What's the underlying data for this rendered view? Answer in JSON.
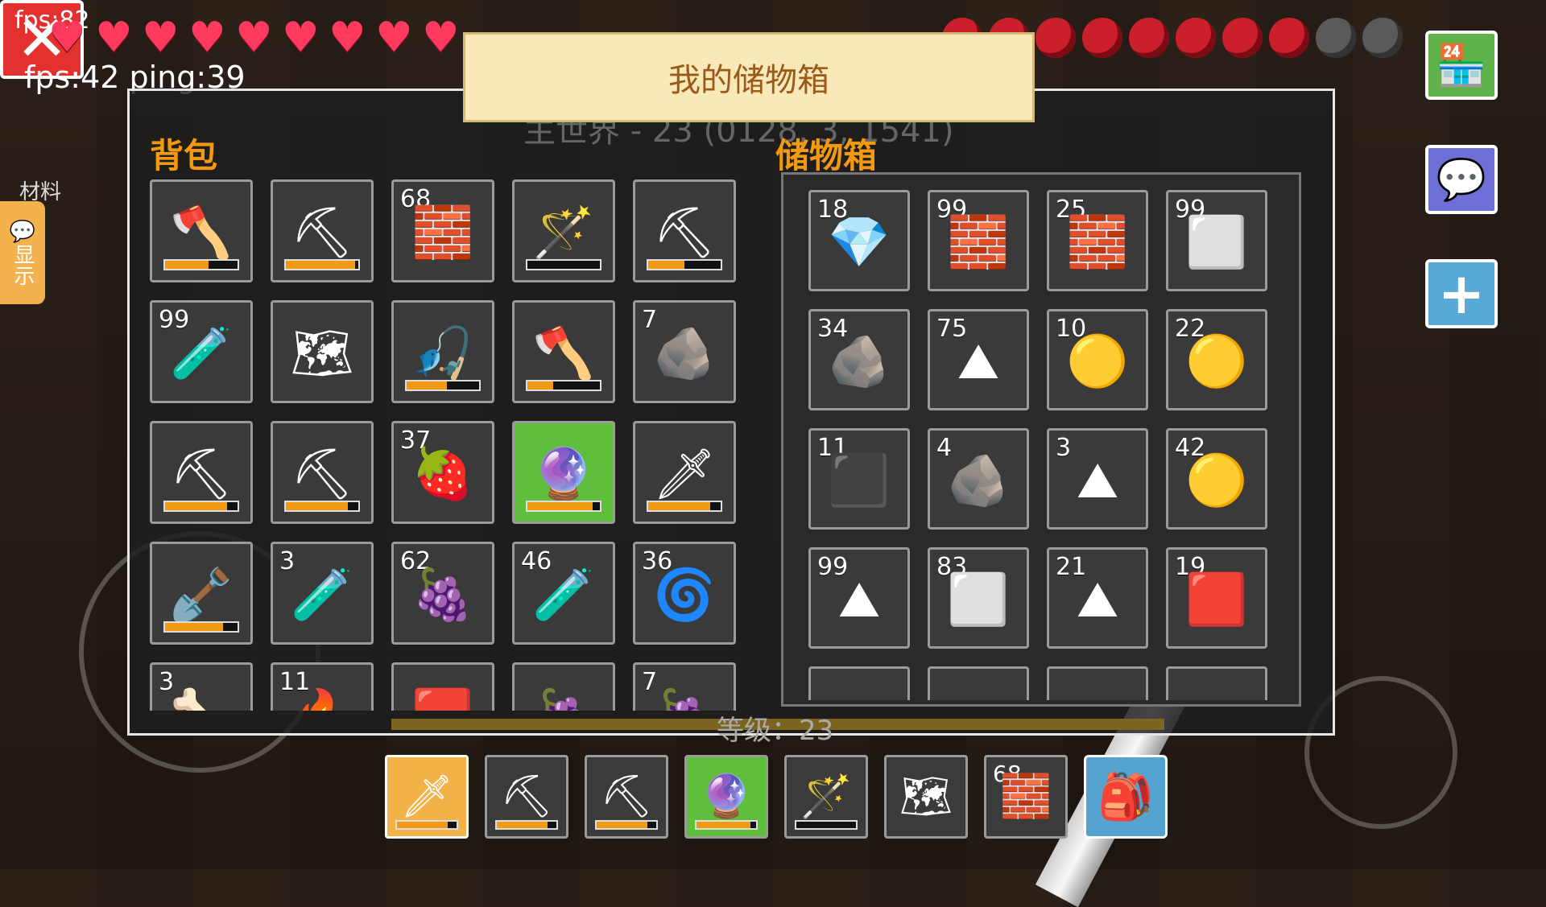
{
  "hud": {
    "fps_top": "fps:82",
    "fps_line": "fps:42 ping:39",
    "hearts": 9,
    "hunger_full": 8,
    "hunger_empty": 2
  },
  "panel": {
    "title": "我的储物箱",
    "subtitle": "主世界 - 23 (0128, 3, 1541)",
    "bag_title": "背包",
    "chest_title": "储物箱",
    "materials_label": "材料",
    "chat_tab": "显示",
    "level_label": "等级：23"
  },
  "bag": [
    {
      "icon": "diamond-axe-icon",
      "glyph": "🪓",
      "count": "",
      "durability": 0.6
    },
    {
      "icon": "diamond-pickaxe-icon",
      "glyph": "⛏",
      "count": "",
      "durability": 0.95
    },
    {
      "icon": "stone-brick-icon",
      "glyph": "🧱",
      "count": "68",
      "durability": null
    },
    {
      "icon": "magic-wand-icon",
      "glyph": "🪄",
      "count": "",
      "durability": 0.0
    },
    {
      "icon": "stone-pickaxe-icon",
      "glyph": "⛏",
      "count": "",
      "durability": 0.5
    },
    {
      "icon": "potion-icon",
      "glyph": "🧪",
      "count": "99",
      "durability": null
    },
    {
      "icon": "map-icon",
      "glyph": "🗺",
      "count": "",
      "durability": null
    },
    {
      "icon": "fishing-rod-icon",
      "glyph": "🎣",
      "count": "",
      "durability": 0.55
    },
    {
      "icon": "stone-axe-icon",
      "glyph": "🪓",
      "count": "",
      "durability": 0.35
    },
    {
      "icon": "copper-ore-icon",
      "glyph": "🪨",
      "count": "7",
      "durability": null
    },
    {
      "icon": "stone-pickaxe-icon",
      "glyph": "⛏",
      "count": "",
      "durability": 0.85
    },
    {
      "icon": "iron-pickaxe-icon",
      "glyph": "⛏",
      "count": "",
      "durability": 0.85
    },
    {
      "icon": "raspberry-icon",
      "glyph": "🍓",
      "count": "37",
      "durability": null
    },
    {
      "icon": "purple-staff-icon",
      "glyph": "🔮",
      "count": "",
      "durability": 0.9,
      "selected": true
    },
    {
      "icon": "iron-sword-icon",
      "glyph": "🗡",
      "count": "",
      "durability": 0.85
    },
    {
      "icon": "stone-shovel-icon",
      "glyph": "🪏",
      "count": "",
      "durability": 0.8
    },
    {
      "icon": "blue-potion-icon",
      "glyph": "🧪",
      "count": "3",
      "durability": null
    },
    {
      "icon": "grapes-icon",
      "glyph": "🍇",
      "count": "62",
      "durability": null
    },
    {
      "icon": "empty-bottle-icon",
      "glyph": "🧪",
      "count": "46",
      "durability": null
    },
    {
      "icon": "string-icon",
      "glyph": "🌀",
      "count": "36",
      "durability": null
    },
    {
      "icon": "bone-icon",
      "glyph": "🦴",
      "count": "3",
      "durability": null
    },
    {
      "icon": "fire-icon",
      "glyph": "🔥",
      "count": "11",
      "durability": null
    },
    {
      "icon": "red-ore-icon",
      "glyph": "🟥",
      "count": "",
      "durability": null
    },
    {
      "icon": "grapes-icon",
      "glyph": "🍇",
      "count": "",
      "durability": null
    },
    {
      "icon": "berries-icon",
      "glyph": "🍇",
      "count": "7",
      "durability": null
    }
  ],
  "chest": [
    {
      "icon": "flint-icon",
      "glyph": "💎",
      "count": "18"
    },
    {
      "icon": "stone-brick-icon",
      "glyph": "🧱",
      "count": "99"
    },
    {
      "icon": "stone-brick-icon",
      "glyph": "🧱",
      "count": "25"
    },
    {
      "icon": "stone-block-icon",
      "glyph": "⬜",
      "count": "99"
    },
    {
      "icon": "coal-icon",
      "glyph": "🪨",
      "count": "34"
    },
    {
      "icon": "black-powder-icon",
      "glyph": "⛰",
      "count": "75"
    },
    {
      "icon": "gold-powder-icon",
      "glyph": "🟡",
      "count": "10"
    },
    {
      "icon": "gold-powder-icon",
      "glyph": "🟡",
      "count": "22"
    },
    {
      "icon": "dark-ore-icon",
      "glyph": "⬛",
      "count": "11"
    },
    {
      "icon": "silver-ore-icon",
      "glyph": "🪨",
      "count": "4"
    },
    {
      "icon": "gray-powder-icon",
      "glyph": "⛰",
      "count": "3"
    },
    {
      "icon": "yellow-powder-icon",
      "glyph": "🟡",
      "count": "42"
    },
    {
      "icon": "white-powder-icon",
      "glyph": "⛰",
      "count": "99"
    },
    {
      "icon": "iron-ingot-icon",
      "glyph": "⬜",
      "count": "83"
    },
    {
      "icon": "white-powder-icon",
      "glyph": "⛰",
      "count": "21"
    },
    {
      "icon": "red-ore-icon",
      "glyph": "🟥",
      "count": "19"
    },
    {
      "icon": "empty-slot",
      "glyph": "",
      "count": ""
    },
    {
      "icon": "empty-slot",
      "glyph": "",
      "count": ""
    },
    {
      "icon": "empty-slot",
      "glyph": "",
      "count": ""
    },
    {
      "icon": "empty-slot",
      "glyph": "",
      "count": ""
    }
  ],
  "hotbar": [
    {
      "icon": "iron-sword-icon",
      "glyph": "🗡",
      "count": "",
      "durability": 0.85,
      "style": "active"
    },
    {
      "icon": "stone-pickaxe-icon",
      "glyph": "⛏",
      "count": "",
      "durability": 0.85,
      "style": ""
    },
    {
      "icon": "iron-pickaxe-icon",
      "glyph": "⛏",
      "count": "",
      "durability": 0.85,
      "style": ""
    },
    {
      "icon": "purple-staff-icon",
      "glyph": "🔮",
      "count": "",
      "durability": 0.9,
      "style": "green"
    },
    {
      "icon": "magic-wand-icon",
      "glyph": "🪄",
      "count": "",
      "durability": 0.0,
      "style": ""
    },
    {
      "icon": "map-icon",
      "glyph": "🗺",
      "count": "",
      "durability": null,
      "style": ""
    },
    {
      "icon": "stone-brick-icon",
      "glyph": "🧱",
      "count": "68",
      "durability": null,
      "style": ""
    }
  ]
}
